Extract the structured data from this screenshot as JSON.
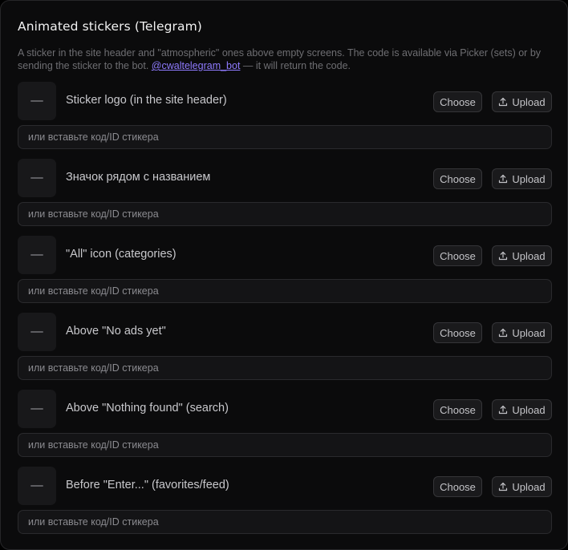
{
  "panel": {
    "title": "Animated stickers (Telegram)",
    "description_before_link": "A sticker in the site header and \"atmospheric\" ones above empty screens. The code is available via Picker (sets) or by sending the sticker to the bot. ",
    "bot_link": "@cwaltelegram_bot",
    "description_after_link": " — it will return the code."
  },
  "buttons": {
    "choose_label": "Choose",
    "upload_label": "Upload"
  },
  "icons": {
    "thumb_placeholder": "dash-icon",
    "upload": "upload-icon"
  },
  "rows": [
    {
      "label": "Sticker logo (in the site header)",
      "code_placeholder": "или вставьте код/ID стикера",
      "code_value": ""
    },
    {
      "label": "Значок рядом с названием",
      "code_placeholder": "или вставьте код/ID стикера",
      "code_value": ""
    },
    {
      "label": "\"All\" icon (categories)",
      "code_placeholder": "или вставьте код/ID стикера",
      "code_value": ""
    },
    {
      "label": "Above \"No ads yet\"",
      "code_placeholder": "или вставьте код/ID стикера",
      "code_value": ""
    },
    {
      "label": "Above \"Nothing found\" (search)",
      "code_placeholder": "или вставьте код/ID стикера",
      "code_value": ""
    },
    {
      "label": "Before \"Enter...\" (favorites/feed)",
      "code_placeholder": "или вставьте код/ID стикера",
      "code_value": ""
    }
  ]
}
